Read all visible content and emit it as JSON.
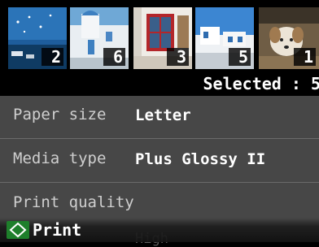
{
  "thumbnails": [
    {
      "count": "2",
      "icon": "photo-sky-boats"
    },
    {
      "count": "6",
      "icon": "photo-white-chapel"
    },
    {
      "count": "3",
      "icon": "photo-red-window"
    },
    {
      "count": "5",
      "icon": "photo-white-buildings"
    },
    {
      "count": "1",
      "icon": "photo-dog"
    }
  ],
  "selection": {
    "text": "Selected : 5"
  },
  "settings": {
    "rows": [
      {
        "label": "Paper size",
        "value": "Letter"
      },
      {
        "label": "Media type",
        "value": "Plus Glossy II"
      },
      {
        "label": "Print quality",
        "value": "High"
      }
    ]
  },
  "footer": {
    "print_label": "Print",
    "start_icon": "green-diamond-start-icon"
  },
  "colors": {
    "panel": "#474747",
    "start_green": "#2e9e3a"
  }
}
